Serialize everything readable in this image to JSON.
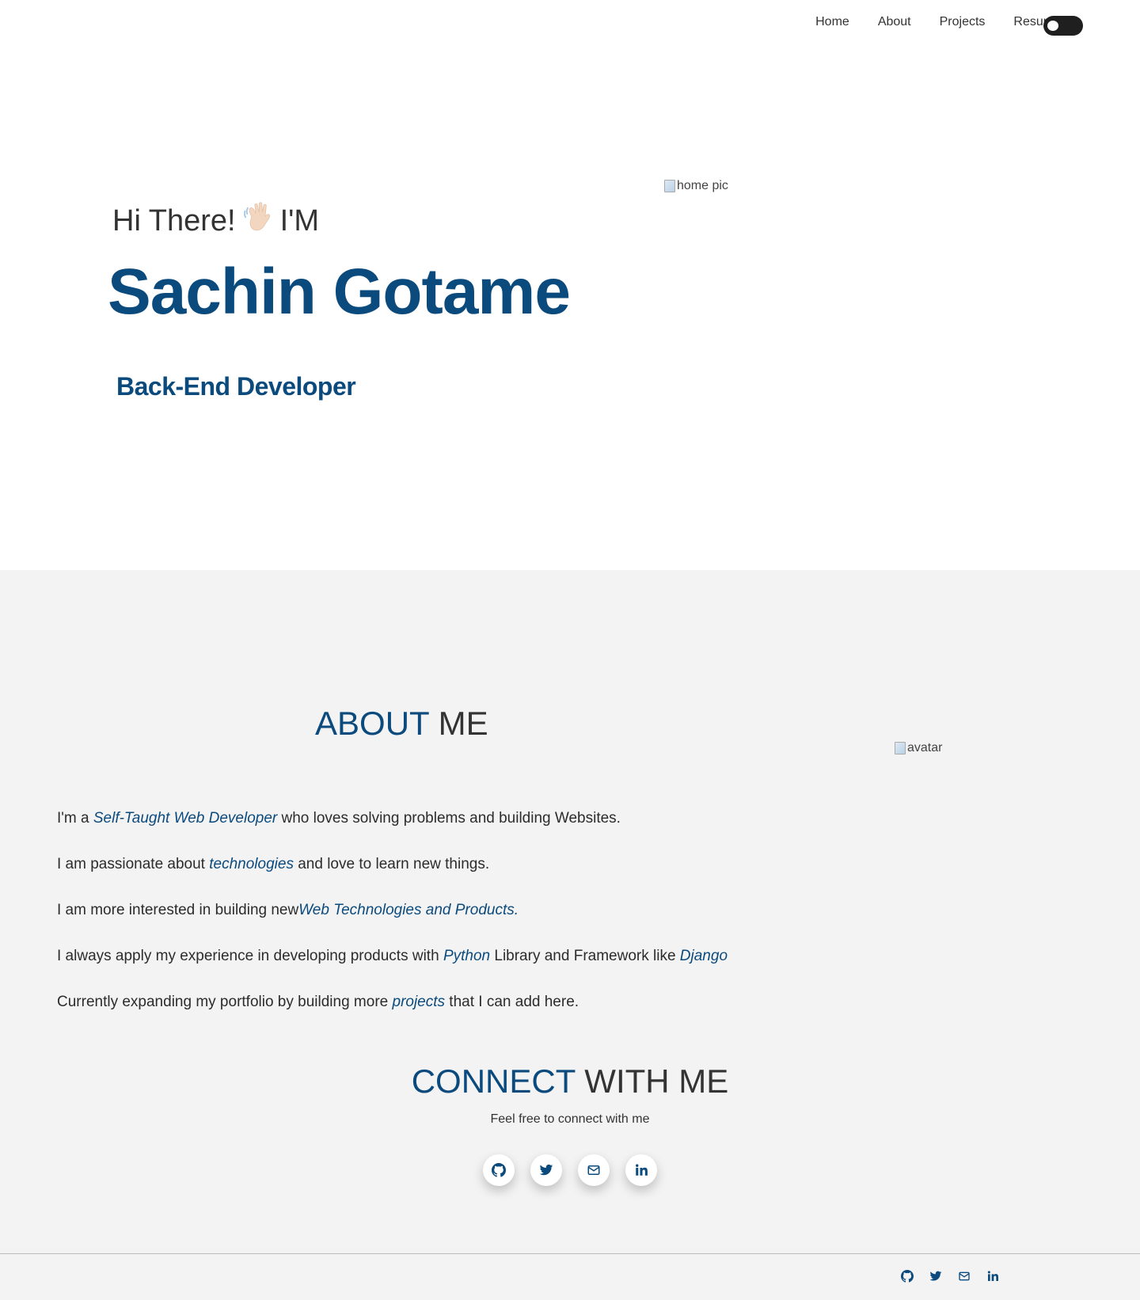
{
  "nav": {
    "links": [
      "Home",
      "About",
      "Projects",
      "Resume"
    ]
  },
  "hero": {
    "greeting_pre": "Hi There!",
    "greeting_post": "I'M",
    "name": "Sachin Gotame",
    "role": "Back-End Developer",
    "image_alt": "home pic"
  },
  "about": {
    "title_accent": "ABOUT",
    "title_rest": "ME",
    "avatar_alt": "avatar",
    "line1_pre": "I'm a ",
    "line1_hl": "Self-Taught Web Developer",
    "line1_post": " who loves solving problems and building Websites.",
    "line2_pre": "I am passionate about ",
    "line2_hl": "technologies",
    "line2_post": " and love to learn new things.",
    "line3_pre": "I am more interested in building new",
    "line3_hl": "Web Technologies and Products.",
    "line4_pre": "I always apply my experience in developing products with ",
    "line4_hl1": "Python",
    "line4_mid": " Library and Framework like ",
    "line4_hl2": "Django",
    "line5_pre": "Currently expanding my portfolio by building more ",
    "line5_hl": "projects",
    "line5_post": " that I can add here."
  },
  "connect": {
    "title_accent": "CONNECT",
    "title_rest": "WITH ME",
    "subtitle": "Feel free to connect with me",
    "icons": [
      "github-icon",
      "twitter-icon",
      "mail-icon",
      "linkedin-icon"
    ]
  },
  "colors": {
    "accent": "#0b4a7d",
    "section_bg": "#f4f3f4",
    "toggle_bg": "#1f1f1f"
  }
}
